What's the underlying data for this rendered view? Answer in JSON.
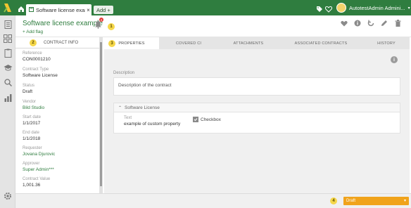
{
  "topbar": {
    "tab_title": "Software license example",
    "tab_close": "×",
    "add_label": "Add +",
    "user_name": "AutotestAdmin Admini..."
  },
  "header": {
    "title": "Software license example",
    "add_flag": "+ Add flag",
    "notification_count": "2"
  },
  "markers": [
    "1",
    "2",
    "3",
    "4"
  ],
  "sidebar": {
    "header": "CONTRACT INFO",
    "fields": [
      {
        "label": "Reference",
        "value": "CON0001210",
        "link": false
      },
      {
        "label": "Contract Type",
        "value": "Software License",
        "link": false
      },
      {
        "label": "Status",
        "value": "Draft",
        "link": false
      },
      {
        "label": "Vendor",
        "value": "Bild Studio",
        "link": true
      },
      {
        "label": "Start date",
        "value": "1/1/2017",
        "link": false
      },
      {
        "label": "End date",
        "value": "1/1/2018",
        "link": false
      },
      {
        "label": "Requester",
        "value": "Jovana Djurovic",
        "link": true
      },
      {
        "label": "Approver",
        "value": "Super Admin***",
        "link": true
      },
      {
        "label": "Contract Value",
        "value": "1,001.36",
        "link": false
      }
    ]
  },
  "tabs": [
    "PROPERTIES",
    "COVERED CI",
    "ATTACHMENTS",
    "ASSOCIATED CONTRACTS",
    "HISTORY"
  ],
  "properties": {
    "description_label": "Description",
    "description_value": "Description of the contract",
    "section_title": "Software License",
    "text_label": "Text",
    "text_value": "example of custom property",
    "checkbox_label": "Checkbox"
  },
  "footer": {
    "status": "Draft"
  },
  "colors": {
    "brand": "#2f7d3f",
    "status": "#f0a31b",
    "badge": "#e53935",
    "marker": "#f5d74a"
  }
}
